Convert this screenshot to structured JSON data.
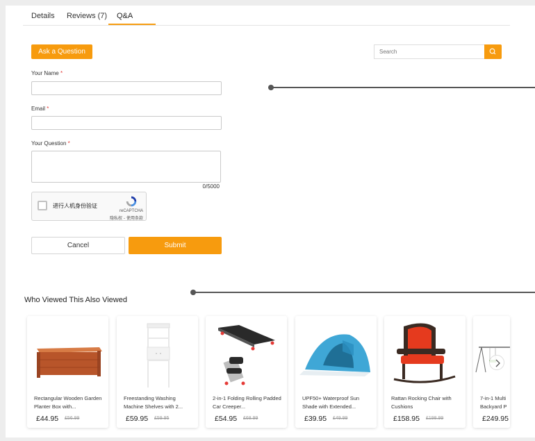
{
  "tabs": [
    {
      "label": "Details"
    },
    {
      "label": "Reviews (7)"
    },
    {
      "label": "Q&A"
    }
  ],
  "ask_button": "Ask a Question",
  "search": {
    "placeholder": "Search"
  },
  "form": {
    "name_label": "Your Name",
    "email_label": "Email",
    "question_label": "Your Question",
    "required_mark": "*",
    "counter": "0/5000",
    "cancel": "Cancel",
    "submit": "Submit"
  },
  "captcha": {
    "label": "进行人机身份验证",
    "brand": "reCAPTCHA",
    "terms": "隐私权 - 使用条款"
  },
  "also_viewed": {
    "title": "Who Viewed This Also Viewed",
    "products": [
      {
        "name": "Rectangular Wooden Garden Planter Box with...",
        "price": "£44.95",
        "old_price": "£56.99"
      },
      {
        "name": "Freestanding Washing Machine Shelves with 2...",
        "price": "£59.95",
        "old_price": "£59.95"
      },
      {
        "name": "2-in-1 Folding Rolling Padded Car Creeper...",
        "price": "£54.95",
        "old_price": "£68.99"
      },
      {
        "name": "UPF50+ Waterproof Sun Shade with Extended...",
        "price": "£39.95",
        "old_price": "£49.99"
      },
      {
        "name": "Rattan Rocking Chair with Cushions",
        "price": "£158.95",
        "old_price": "£198.99"
      },
      {
        "name": "7-in-1 Multi Backyard P",
        "price": "£249.95",
        "old_price": ""
      }
    ]
  },
  "colors": {
    "accent": "#f79b0e",
    "required": "#e53935"
  }
}
